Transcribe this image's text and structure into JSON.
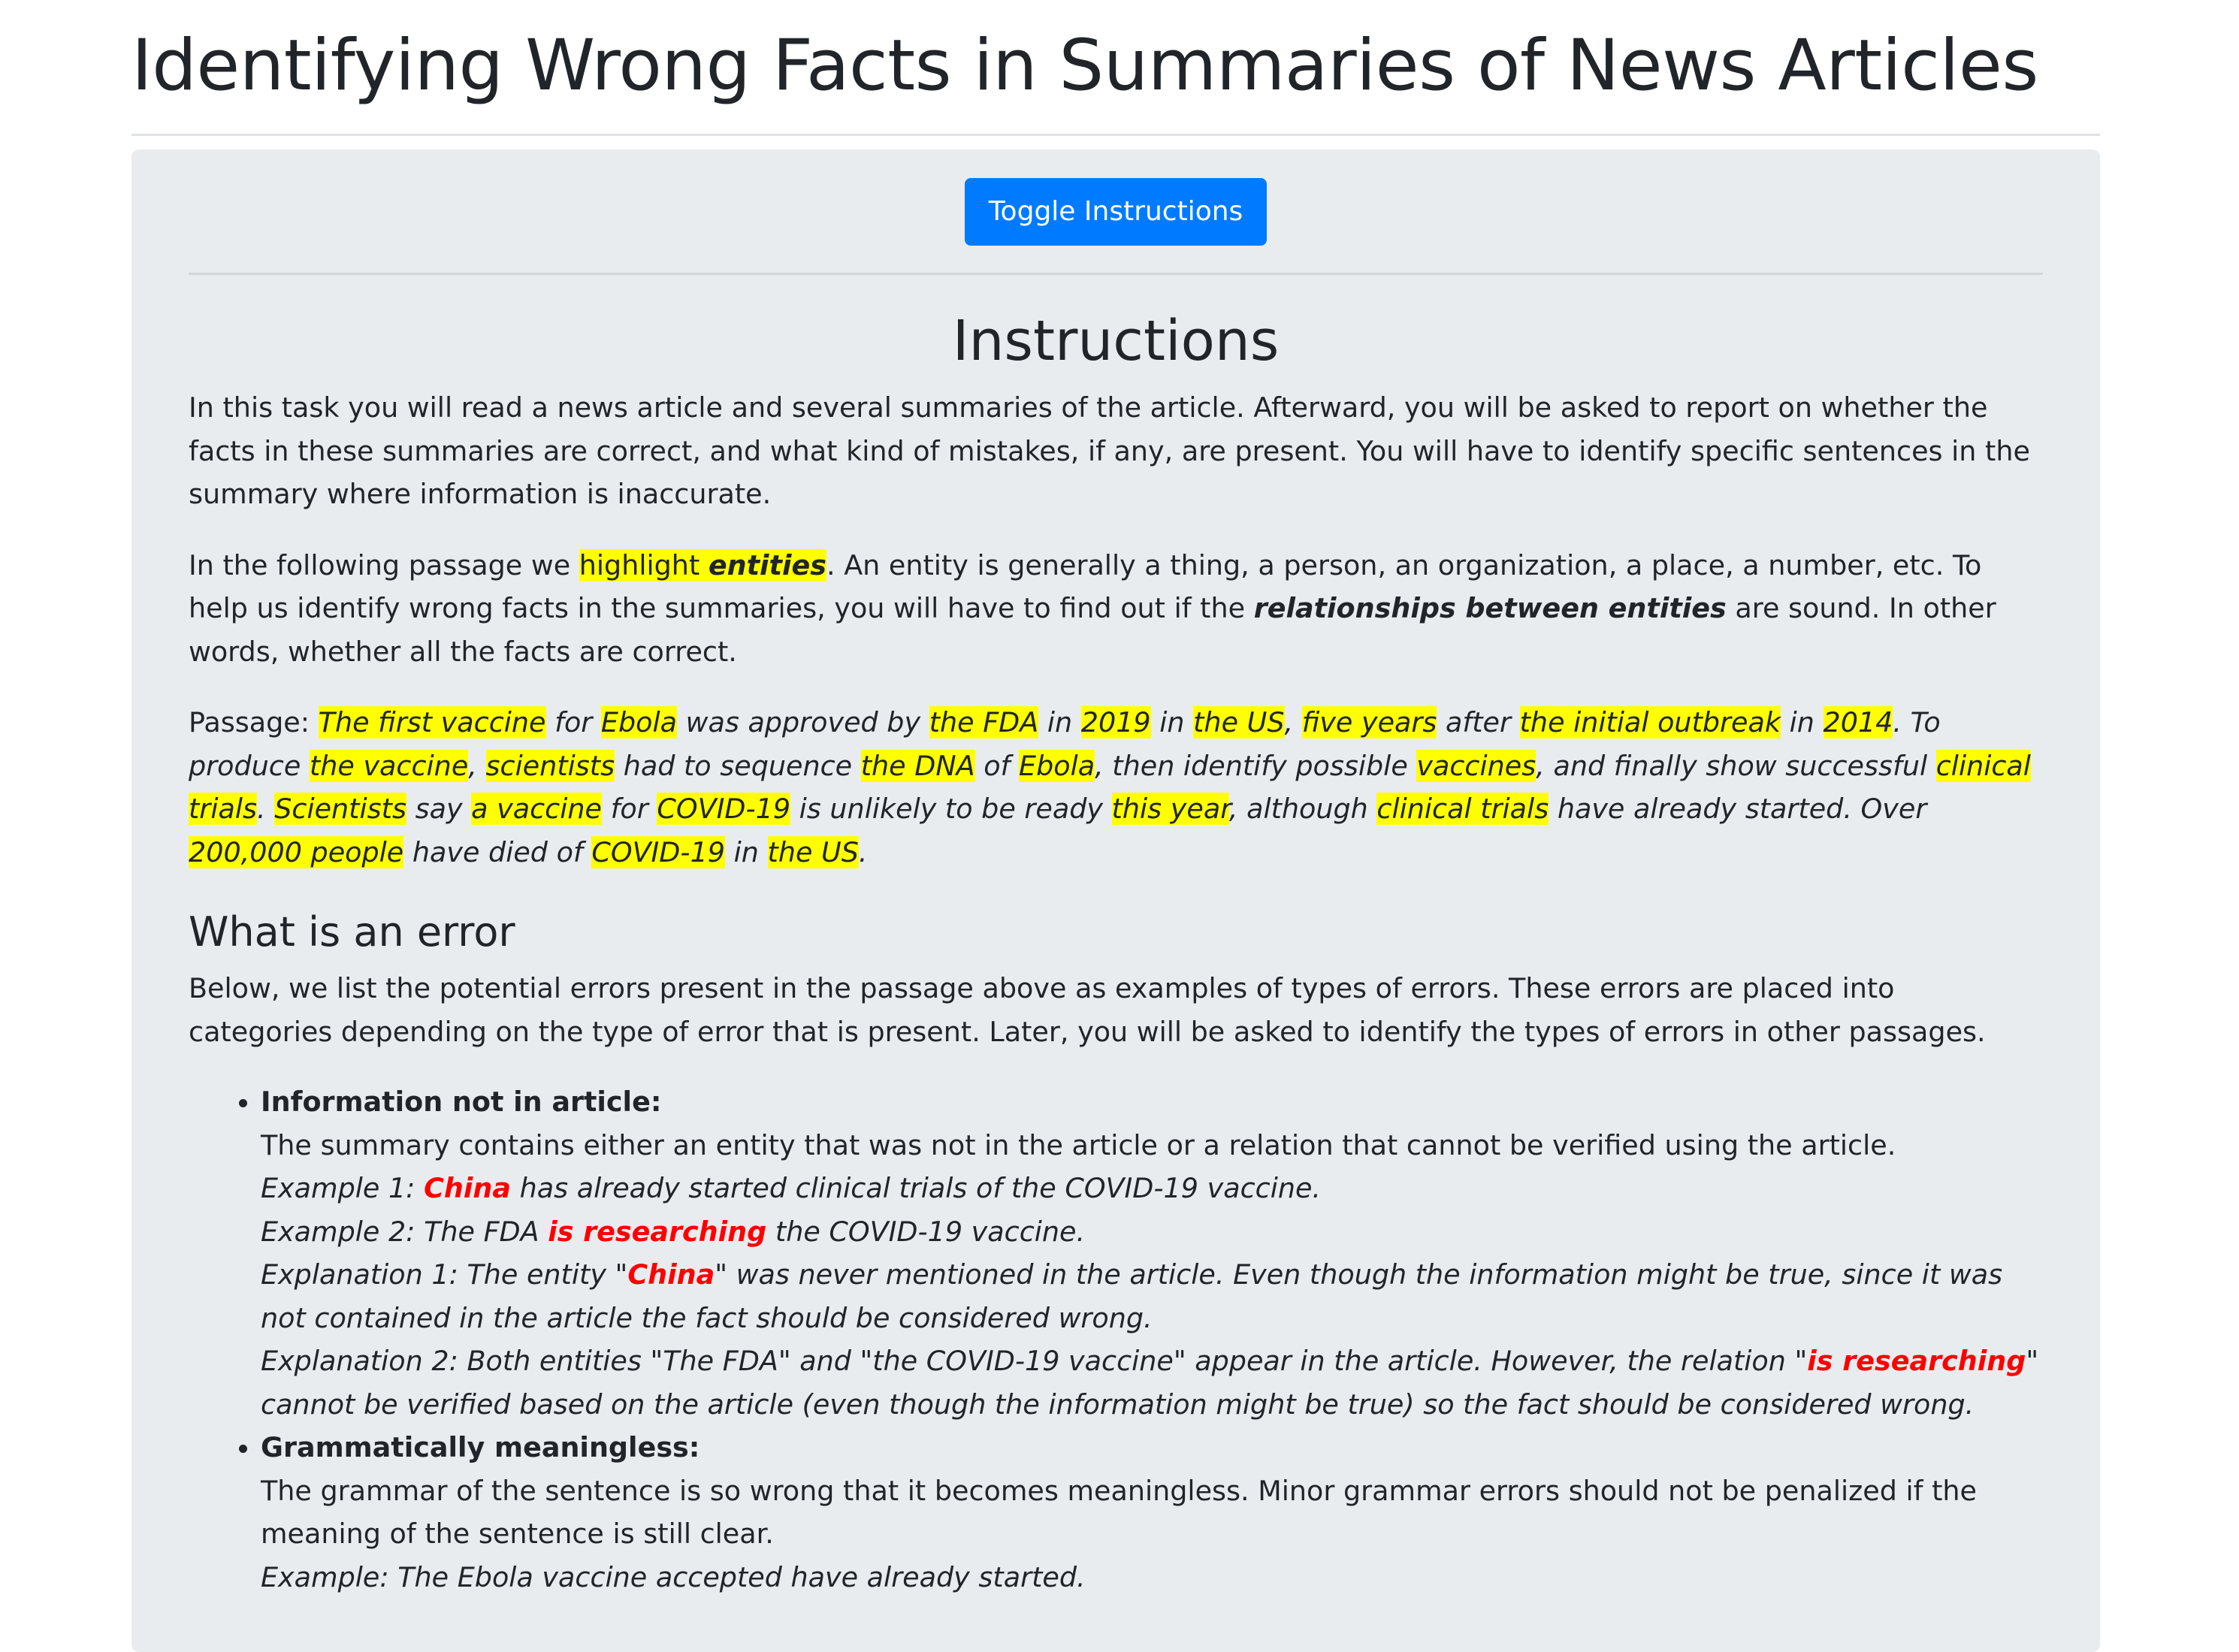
{
  "page_title": "Identifying Wrong Facts in Summaries of News Articles",
  "toggle_button": "Toggle Instructions",
  "instructions": {
    "heading": "Instructions",
    "intro": "In this task you will read a news article and several summaries of the article. Afterward, you will be asked to report on whether the facts in these summaries are correct, and what kind of mistakes, if any, are present. You will have to identify specific sentences in the summary where information is inaccurate.",
    "p2": {
      "t1": "In the following passage we ",
      "hl1": "highlight ",
      "hl1b": "entities",
      "t2": ". An entity is generally a thing, a person, an organization, a place, a number, etc. To help us identify wrong facts in the summaries, you will have to find out if the ",
      "b1": "relationships between entities",
      "t3": " are sound. In other words, whether all the facts are correct."
    },
    "passage": {
      "label": "Passage: ",
      "s": [
        "The first vaccine",
        " for ",
        "Ebola",
        " was approved by ",
        "the FDA",
        " in ",
        "2019",
        " in ",
        "the US",
        ", ",
        "five years",
        " after ",
        "the initial outbreak",
        " in ",
        "2014",
        ". To produce ",
        "the vaccine",
        ", ",
        "scientists",
        " had to sequence ",
        "the DNA",
        " of ",
        "Ebola",
        ", then identify possible ",
        "vaccines",
        ", and finally show successful ",
        "clinical trials",
        ". ",
        "Scientists",
        " say ",
        "a vaccine",
        " for ",
        "COVID-19",
        " is unlikely to be ready ",
        "this year",
        ", although ",
        "clinical trials",
        " have already started. Over ",
        "200,000 people",
        " have died of ",
        "COVID-19",
        " in ",
        "the US",
        "."
      ]
    }
  },
  "errors": {
    "heading": "What is an error",
    "intro": "Below, we list the potential errors present in the passage above as examples of types of errors. These errors are placed into categories depending on the type of error that is present. Later, you will be asked to identify the types of errors in other passages.",
    "items": [
      {
        "title": "Information not in article:",
        "desc": "The summary contains either an entity that was not in the article or a relation that cannot be verified using the article.",
        "ex1_a": "Example 1: ",
        "ex1_red": "China",
        "ex1_b": " has already started clinical trials of the COVID-19 vaccine.",
        "ex2_a": "Example 2: The FDA ",
        "ex2_red": "is researching",
        "ex2_b": " the COVID-19 vaccine.",
        "exp1_a": "Explanation 1: The entity \"",
        "exp1_red": "China",
        "exp1_b": "\" was never mentioned in the article. Even though the information might be true, since it was not contained in the article the fact should be considered wrong.",
        "exp2_a": "Explanation 2: Both entities \"The FDA\" and \"the COVID-19 vaccine\" appear in the article. However, the relation \"",
        "exp2_red": "is researching",
        "exp2_b": "\" cannot be verified based on the article (even though the information might be true) so the fact should be considered wrong."
      },
      {
        "title": "Grammatically meaningless:",
        "desc": "The grammar of the sentence is so wrong that it becomes meaningless. Minor grammar errors should not be penalized if the meaning of the sentence is still clear.",
        "ex": "Example: The Ebola vaccine accepted have already started."
      }
    ]
  },
  "colors": {
    "highlight": "#ffff00",
    "error_red": "#ff0000",
    "button_blue": "#007bff",
    "panel_gray": "#e9ecef"
  }
}
